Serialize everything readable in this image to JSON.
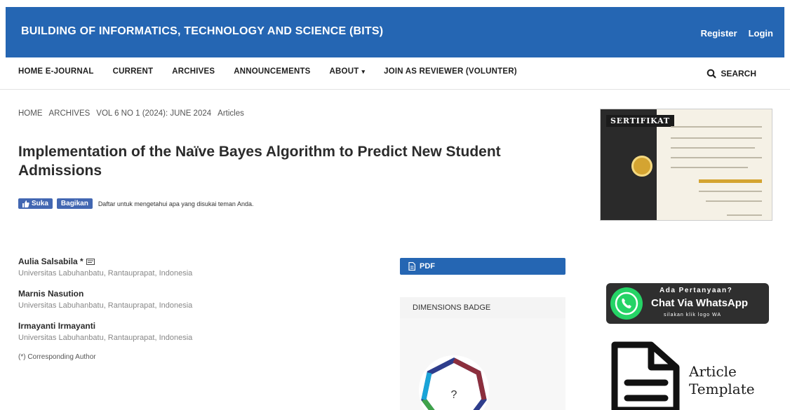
{
  "header": {
    "brand": "BUILDING OF INFORMATICS, TECHNOLOGY AND SCIENCE (BITS)",
    "register": "Register",
    "login": "Login",
    "color": "#2566b3"
  },
  "nav": {
    "items": [
      {
        "label": "HOME E-JOURNAL"
      },
      {
        "label": "CURRENT"
      },
      {
        "label": "ARCHIVES"
      },
      {
        "label": "ANNOUNCEMENTS"
      },
      {
        "label": "ABOUT"
      },
      {
        "label": "JOIN AS REVIEWER (VOLUNTER)"
      }
    ],
    "about_caret": "▾",
    "search": "SEARCH"
  },
  "breadcrumb": [
    "HOME",
    "ARCHIVES",
    "VOL 6 NO 1 (2024): JUNE 2024",
    "Articles"
  ],
  "article": {
    "title": "Implementation of the Naïve Bayes Algorithm to Predict New Student Admissions"
  },
  "social": {
    "like": "Suka",
    "share": "Bagikan",
    "text": "Daftar untuk mengetahui apa yang disukai teman Anda."
  },
  "authors": [
    {
      "name": "Aulia Salsabila *",
      "affiliation": "Universitas Labuhanbatu, Rantauprapat, Indonesia"
    },
    {
      "name": "Marnis Nasution",
      "affiliation": "Universitas Labuhanbatu, Rantauprapat, Indonesia"
    },
    {
      "name": "Irmayanti Irmayanti",
      "affiliation": "Universitas Labuhanbatu, Rantauprapat, Indonesia"
    }
  ],
  "corresponding": "(*) Corresponding Author",
  "galley": {
    "pdf": "PDF"
  },
  "dimensions": {
    "heading": "DIMENSIONS BADGE",
    "value": "?"
  },
  "sidebar": {
    "certificate_title": "SERTIFIKAT",
    "whatsapp": {
      "question": "Ada Pertanyaan?",
      "main": "Chat Via WhatsApp",
      "sub": "silakan klik logo WA"
    },
    "template": {
      "line1": "Article",
      "line2": "Template"
    }
  }
}
